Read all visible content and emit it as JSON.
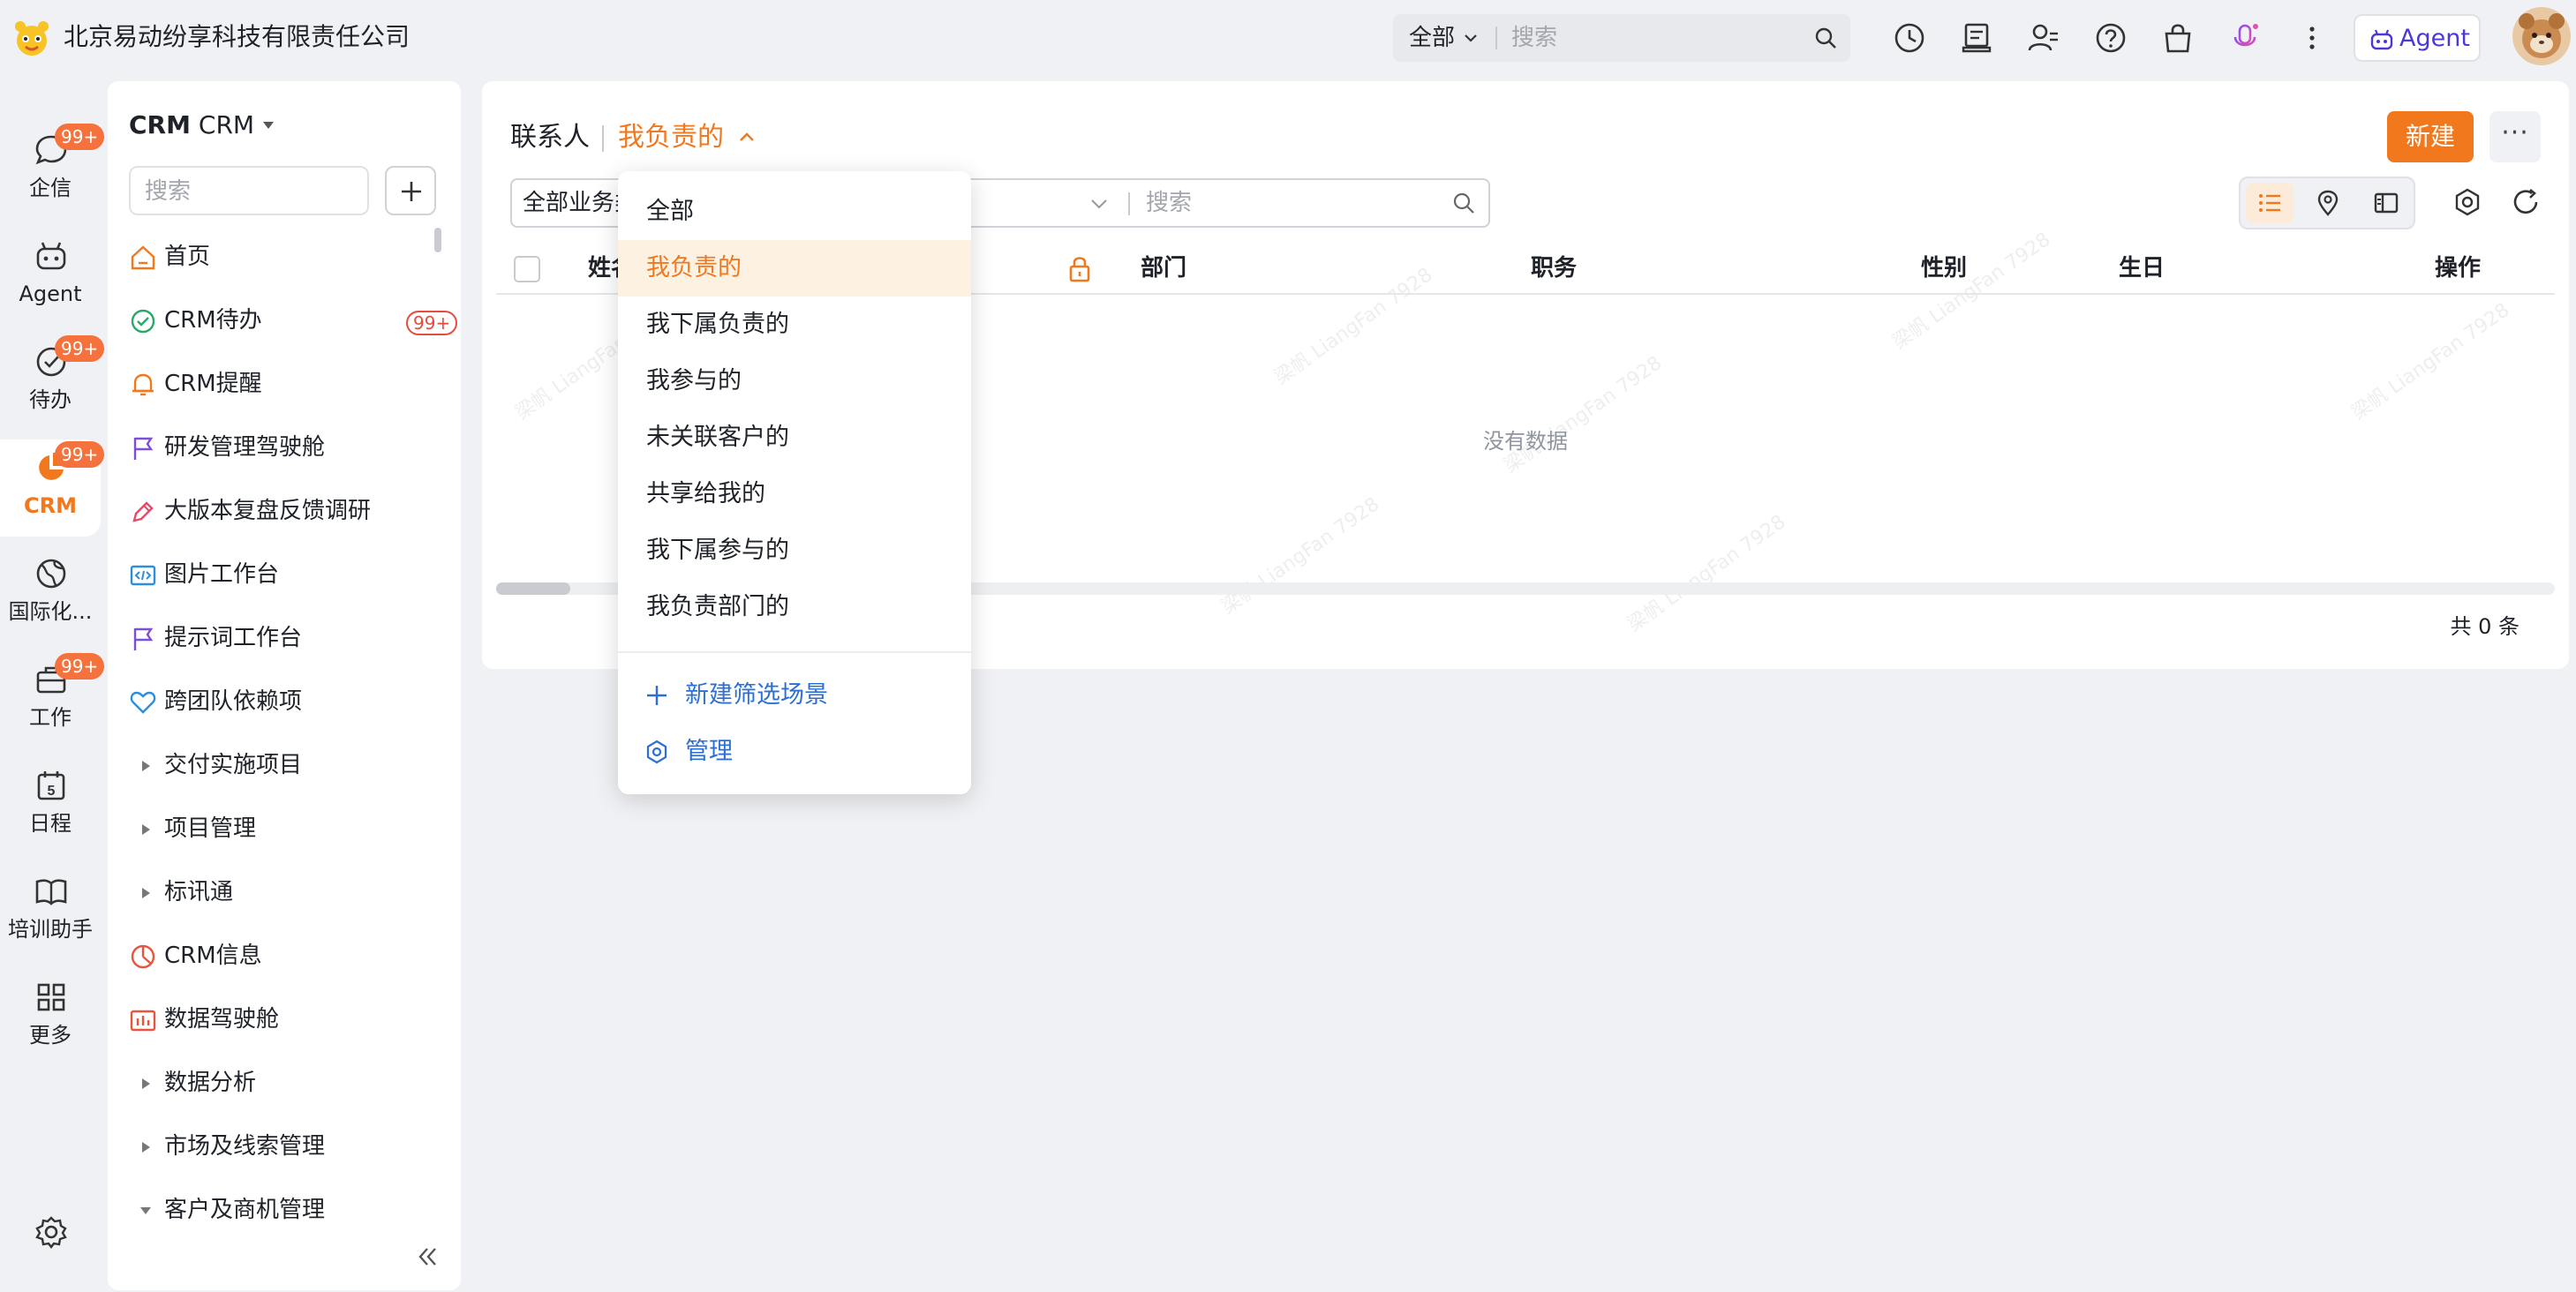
{
  "topbar": {
    "company_name": "北京易动纷享科技有限责任公司",
    "search_scope": "全部",
    "search_placeholder": "搜索",
    "icons": [
      "history-icon",
      "receipt-icon",
      "contacts-icon",
      "help-icon",
      "bag-icon",
      "microphone-icon",
      "more-vertical-icon"
    ],
    "agent_label": "Agent"
  },
  "rail": {
    "items": [
      {
        "label": "企信",
        "icon": "chat-bubble-icon",
        "badge": "99+"
      },
      {
        "label": "Agent",
        "icon": "robot-icon",
        "badge": ""
      },
      {
        "label": "待办",
        "icon": "check-circle-icon",
        "badge": "99+"
      },
      {
        "label": "CRM",
        "icon": "pie-chart-icon",
        "badge": "99+",
        "active": true
      },
      {
        "label": "国际化...",
        "icon": "globe-icon",
        "badge": ""
      },
      {
        "label": "工作",
        "icon": "briefcase-icon",
        "badge": "99+"
      },
      {
        "label": "日程",
        "icon": "calendar-icon",
        "badge": "",
        "calendar_day": "5"
      },
      {
        "label": "培训助手",
        "icon": "book-icon",
        "badge": ""
      },
      {
        "label": "更多",
        "icon": "grid-icon",
        "badge": ""
      }
    ],
    "settings_icon": "settings-gear-icon"
  },
  "sidebar": {
    "title_bold": "CRM",
    "title_rest": "CRM",
    "search_placeholder": "搜索",
    "items": [
      {
        "label": "首页",
        "icon": "home-icon"
      },
      {
        "label": "CRM待办",
        "icon": "check-circle-icon",
        "badge": "99+"
      },
      {
        "label": "CRM提醒",
        "icon": "bell-icon"
      },
      {
        "label": "研发管理驾驶舱",
        "icon": "flag-icon"
      },
      {
        "label": "大版本复盘反馈调研",
        "icon": "pen-icon"
      },
      {
        "label": "图片工作台",
        "icon": "code-image-icon"
      },
      {
        "label": "提示词工作台",
        "icon": "flag-icon"
      },
      {
        "label": "跨团队依赖项",
        "icon": "heart-icon"
      },
      {
        "label": "交付实施项目",
        "icon": "caret-right-icon"
      },
      {
        "label": "项目管理",
        "icon": "caret-right-icon"
      },
      {
        "label": "标讯通",
        "icon": "caret-right-icon"
      },
      {
        "label": "CRM信息",
        "icon": "clock-pie-icon"
      },
      {
        "label": "数据驾驶舱",
        "icon": "bar-chart-icon"
      },
      {
        "label": "数据分析",
        "icon": "caret-right-icon"
      },
      {
        "label": "市场及线索管理",
        "icon": "caret-right-icon"
      },
      {
        "label": "客户及商机管理",
        "icon": "caret-down-icon"
      }
    ]
  },
  "main": {
    "object_name": "联系人",
    "current_view": "我负责的",
    "new_label": "新建",
    "more_label": "···",
    "filter_scope": "全部业务类型",
    "filter_search_placeholder": "搜索",
    "columns": [
      "姓名",
      "部门",
      "职务",
      "性别",
      "生日",
      "操作"
    ],
    "empty_text": "没有数据",
    "total_text": "共 0 条",
    "watermark": "梁帆 LiangFan 7928"
  },
  "dropdown": {
    "options": [
      "全部",
      "我负责的",
      "我下属负责的",
      "我参与的",
      "未关联客户的",
      "共享给我的",
      "我下属参与的",
      "我负责部门的"
    ],
    "selected_index": 1,
    "add_scene_label": "新建筛选场景",
    "manage_label": "管理"
  },
  "colors": {
    "accent": "#f2781e",
    "link": "#2b6fd6",
    "badge": "#f5723c",
    "agent": "#4a39d6"
  }
}
